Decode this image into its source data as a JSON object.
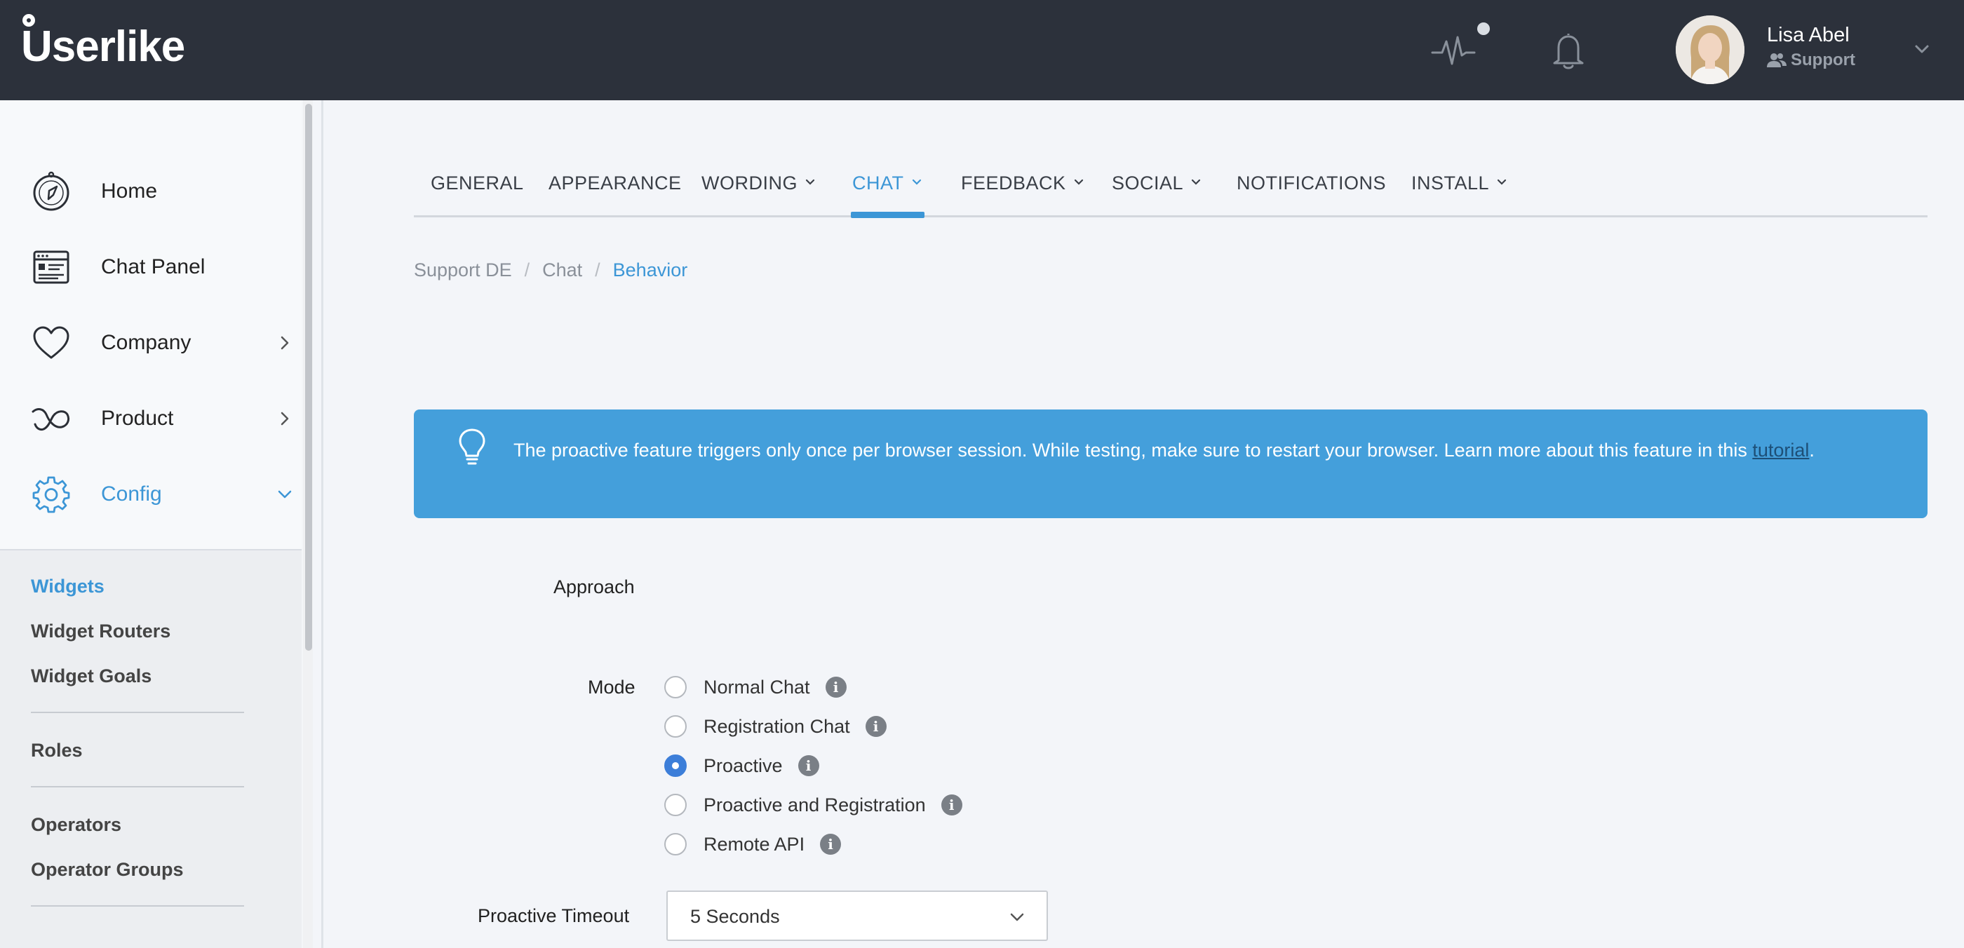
{
  "header": {
    "logo": "Userlike",
    "user_name": "Lisa Abel",
    "user_role": "Support",
    "icons": [
      "activity-icon",
      "bell-icon",
      "user-group-icon",
      "chevron-down-icon"
    ]
  },
  "sidebar": {
    "nav": [
      {
        "label": "Home",
        "icon": "compass-icon"
      },
      {
        "label": "Chat Panel",
        "icon": "chat-panel-icon"
      },
      {
        "label": "Company",
        "icon": "heart-icon"
      },
      {
        "label": "Product",
        "icon": "product-icon"
      },
      {
        "label": "Config",
        "icon": "gear-icon"
      }
    ],
    "sub_links": [
      "Widgets",
      "Widget Routers",
      "Widget Goals",
      "Roles",
      "Operators",
      "Operator Groups"
    ]
  },
  "tabs": [
    "GENERAL",
    "APPEARANCE",
    "WORDING",
    "CHAT",
    "FEEDBACK",
    "SOCIAL",
    "NOTIFICATIONS",
    "INSTALL"
  ],
  "active_tab": "CHAT",
  "breadcrumb": {
    "items": [
      "Support DE",
      "Chat",
      "Behavior"
    ],
    "separator": "/"
  },
  "banner": {
    "text": "The proactive feature triggers only once per browser session. While testing, make sure to restart your browser. Learn more about this feature in this ",
    "link": "tutorial",
    "suffix": ".",
    "icon": "lightbulb-icon"
  },
  "form": {
    "section_title": "Approach",
    "mode_label": "Mode",
    "mode_options": [
      "Normal Chat",
      "Registration Chat",
      "Proactive",
      "Proactive and Registration",
      "Remote API"
    ],
    "mode_selected": "Proactive",
    "timeout_label": "Proactive Timeout",
    "timeout_value": "5 Seconds"
  },
  "colors": {
    "accent": "#3c96d6",
    "topbar": "#2c313b",
    "banner": "#449fdb",
    "radio_checked": "#3c7ed9"
  }
}
